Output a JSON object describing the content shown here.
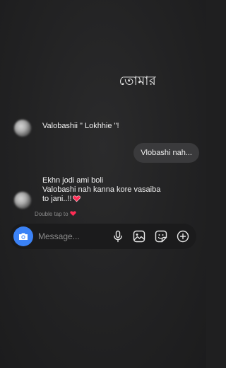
{
  "header": {
    "title": "তোমার"
  },
  "messages": {
    "incoming_1": "Valobashii \" Lokhhie \"!",
    "outgoing_1": "Vlobashi nah...",
    "incoming_2": {
      "line1": "Ekhn jodi ami boli",
      "line2": "Valobashi nah kanna kore vasaiba",
      "line3": "to jani..!!"
    }
  },
  "hint": {
    "text": "Double tap to"
  },
  "composer": {
    "placeholder": "Message..."
  },
  "icons": {
    "camera": "camera-icon",
    "mic": "microphone-icon",
    "gallery": "gallery-icon",
    "sticker": "sticker-icon",
    "plus": "plus-icon",
    "heart": "heart-icon"
  },
  "colors": {
    "background": "#1f1f20",
    "bubble": "#3a3a3c",
    "accent": "#3b82f6",
    "heart": "#ff2d55"
  }
}
